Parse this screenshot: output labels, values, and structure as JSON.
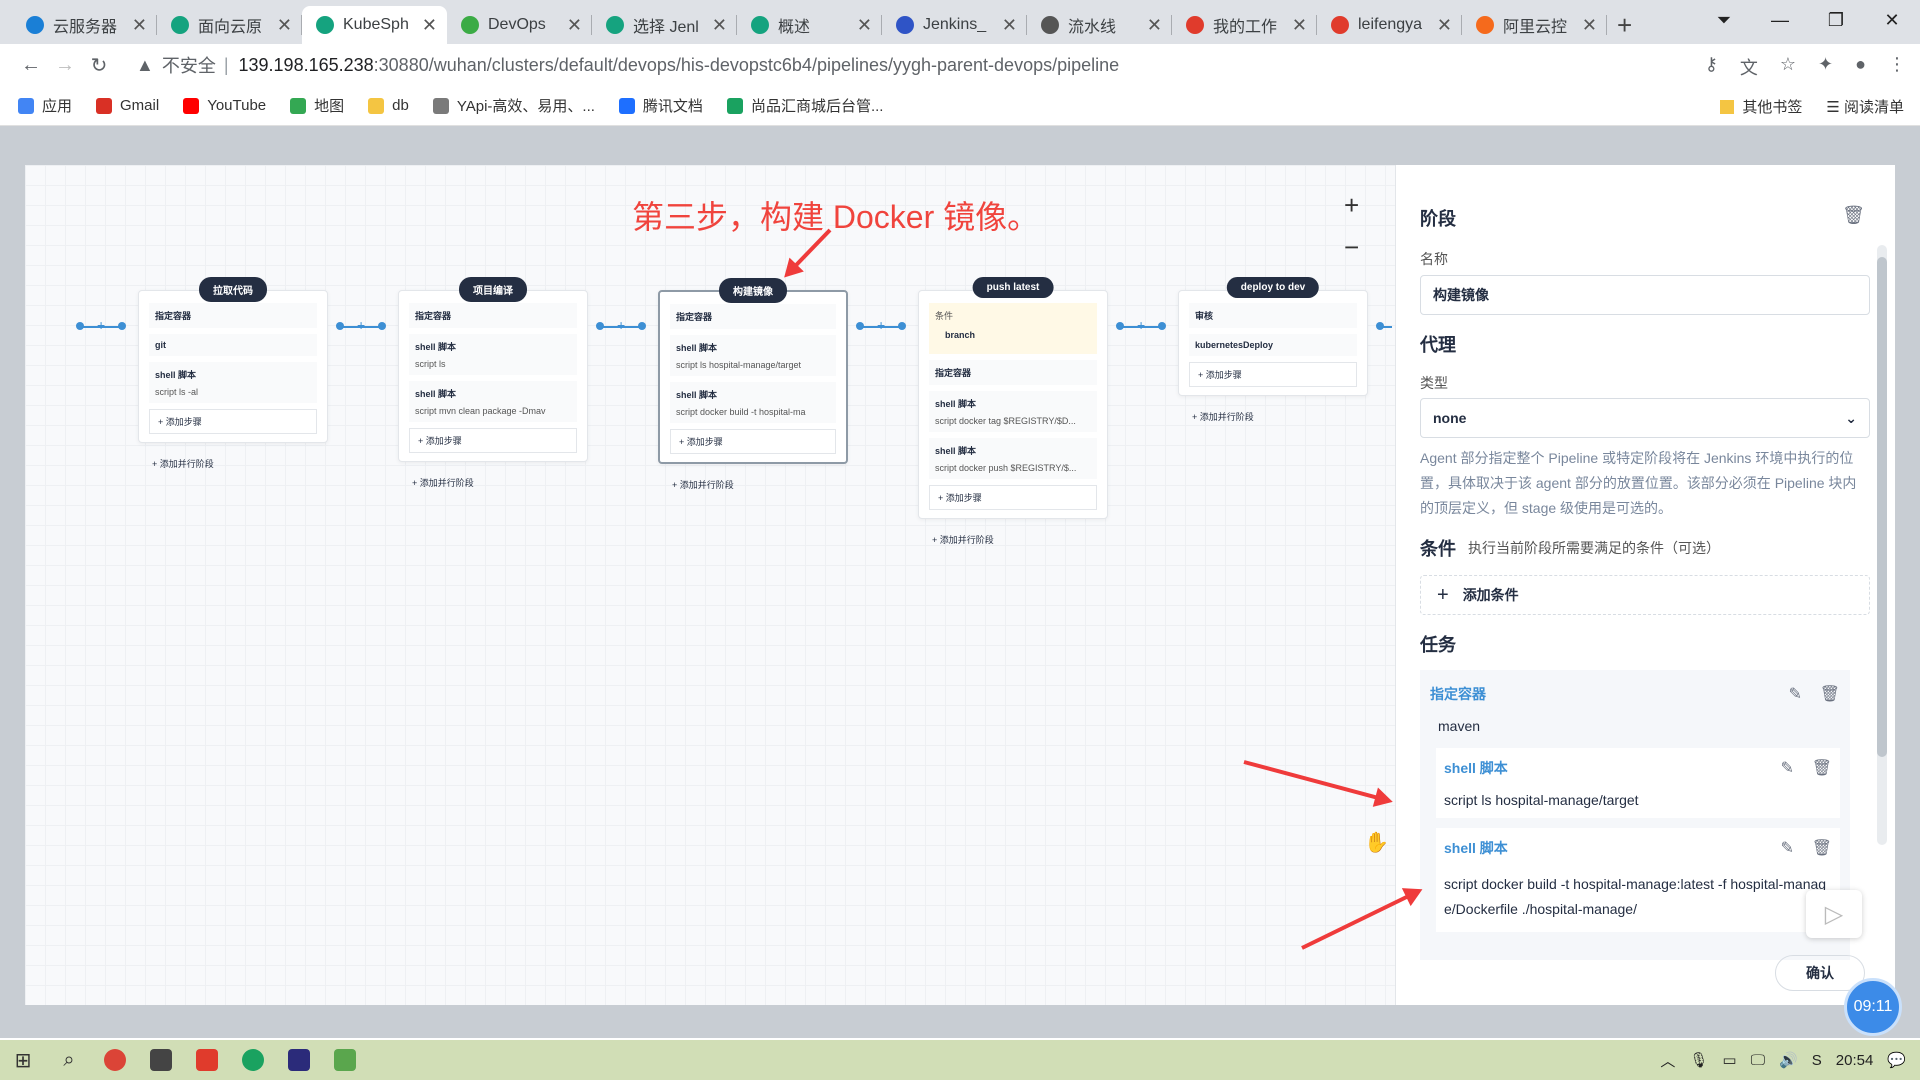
{
  "tabs": [
    {
      "label": "云服务器",
      "color": "#1a7fd6",
      "active": false
    },
    {
      "label": "面向云原",
      "color": "#15a37f",
      "active": false
    },
    {
      "label": "KubeSph",
      "color": "#15a37f",
      "active": true
    },
    {
      "label": "DevOps",
      "color": "#3bab45",
      "active": false
    },
    {
      "label": "选择 Jenl",
      "color": "#15a37f",
      "active": false
    },
    {
      "label": "概述",
      "color": "#15a37f",
      "active": false
    },
    {
      "label": "Jenkins_",
      "color": "#2f54c6",
      "active": false
    },
    {
      "label": "流水线",
      "color": "#555555",
      "active": false
    },
    {
      "label": "我的工作",
      "color": "#e03b2c",
      "active": false
    },
    {
      "label": "leifengya",
      "color": "#e03b2c",
      "active": false
    },
    {
      "label": "阿里云控",
      "color": "#f56a1c",
      "active": false
    }
  ],
  "address": {
    "security": "不安全",
    "host": "139.198.165.238",
    "path": ":30880/wuhan/clusters/default/devops/his-devopstc6b4/pipelines/yygh-parent-devops/pipeline"
  },
  "bookmarks": [
    {
      "label": "应用",
      "color": "#4285f4"
    },
    {
      "label": "Gmail",
      "color": "#d93025"
    },
    {
      "label": "YouTube",
      "color": "#ff0000"
    },
    {
      "label": "地图",
      "color": "#34a853"
    },
    {
      "label": "db",
      "color": "#f4c542"
    },
    {
      "label": "YApi-高效、易用、...",
      "color": "#7a7a7a"
    },
    {
      "label": "腾讯文档",
      "color": "#1e6fff"
    },
    {
      "label": "尚品汇商城后台管...",
      "color": "#1aa260"
    }
  ],
  "bookmarks_right": {
    "other": "其他书签",
    "reading": "阅读清单"
  },
  "annotation": "第三步，构建 Docker 镜像。",
  "stages": [
    {
      "title": "拉取代码",
      "blocks": [
        {
          "h": "指定容器"
        },
        {
          "h": "git"
        },
        {
          "h": "shell 脚本",
          "s": "script   ls -al"
        }
      ],
      "add_step": "添加步骤",
      "add_par": "添加并行阶段"
    },
    {
      "title": "项目编译",
      "blocks": [
        {
          "h": "指定容器"
        },
        {
          "h": "shell 脚本",
          "s": "script   ls"
        },
        {
          "h": "shell 脚本",
          "s": "script   mvn clean package -Dmav"
        }
      ],
      "add_step": "添加步骤",
      "add_par": "添加并行阶段"
    },
    {
      "title": "构建镜像",
      "blocks": [
        {
          "h": "指定容器"
        },
        {
          "h": "shell 脚本",
          "s": "script   ls hospital-manage/target"
        },
        {
          "h": "shell 脚本",
          "s": "script   docker build -t hospital-ma"
        }
      ],
      "add_step": "添加步骤",
      "add_par": "添加并行阶段"
    },
    {
      "title": "push latest",
      "cond_label": "条件",
      "cond": "branch",
      "blocks": [
        {
          "h": "指定容器"
        },
        {
          "h": "shell 脚本",
          "s": "script   docker tag $REGISTRY/$D..."
        },
        {
          "h": "shell 脚本",
          "s": "script   docker push $REGISTRY/$..."
        }
      ],
      "add_step": "添加步骤",
      "add_par": "添加并行阶段"
    },
    {
      "title": "deploy to dev",
      "blocks": [
        {
          "h": "审核"
        },
        {
          "h": "kubernetesDeploy"
        }
      ],
      "add_step": "添加步骤",
      "add_par": "添加并行阶段"
    }
  ],
  "panel": {
    "stage_title": "阶段",
    "name_label": "名称",
    "name_value": "构建镜像",
    "agent_title": "代理",
    "type_label": "类型",
    "type_value": "none",
    "agent_desc": "Agent 部分指定整个 Pipeline 或特定阶段将在 Jenkins 环境中执行的位置，具体取决于该 agent 部分的放置位置。该部分必须在 Pipeline 块内的顶层定义，但 stage 级使用是可选的。",
    "cond_title": "条件",
    "cond_hint": "执行当前阶段所需要满足的条件（可选）",
    "add_cond": "添加条件",
    "tasks_title": "任务",
    "container_name": "指定容器",
    "container_value": "maven",
    "task1_name": "shell 脚本",
    "task1_script": "script   ls hospital-manage/target",
    "task2_name": "shell 脚本",
    "task2_script": "script   docker build -t hospital-manage:latest -f hospital-manage/Dockerfile ./hospital-manage/",
    "confirm": "确认"
  },
  "badge_time": "09:11",
  "clock": "20:54"
}
